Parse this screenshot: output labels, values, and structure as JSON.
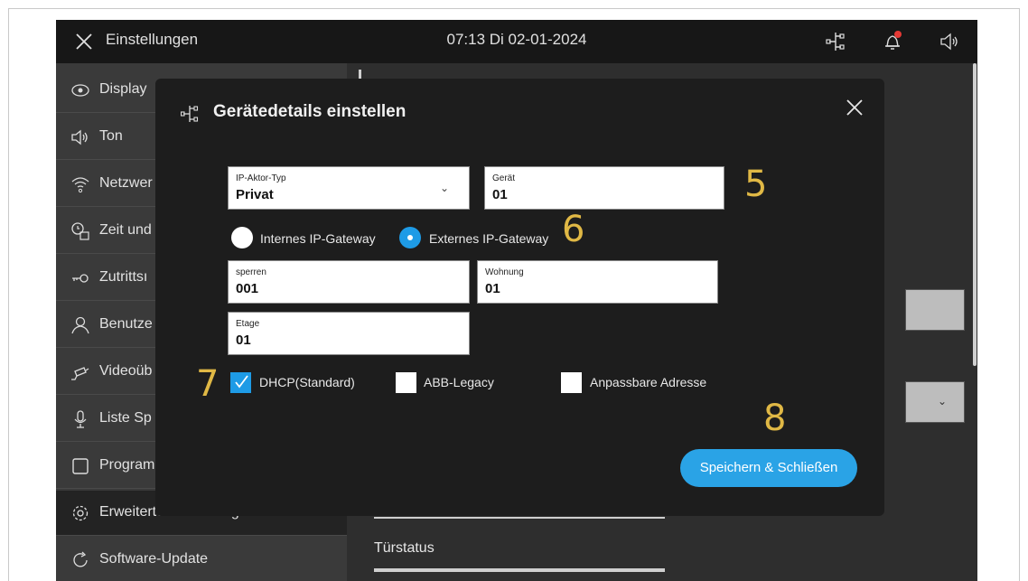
{
  "topbar": {
    "title": "Einstellungen",
    "clock": "07:13  Di 02-01-2024",
    "icons": [
      "close-icon",
      "network-tree-icon",
      "bell-icon",
      "speaker-icon"
    ],
    "notification_color": "#e53935"
  },
  "sidebar": {
    "items": [
      {
        "label": "Display",
        "icon": "eye-icon"
      },
      {
        "label": "Ton",
        "icon": "speaker-icon"
      },
      {
        "label": "Netzwer",
        "icon": "wifi-icon"
      },
      {
        "label": "Zeit und",
        "icon": "clock-calendar-icon"
      },
      {
        "label": "Zutrittsı",
        "icon": "key-icon"
      },
      {
        "label": "Benutze",
        "icon": "user-icon"
      },
      {
        "label": "Videoüb",
        "icon": "camera-icon"
      },
      {
        "label": "Liste Sp",
        "icon": "microphone-icon"
      },
      {
        "label": "Program",
        "icon": "square-icon"
      },
      {
        "label": "Erweiterte Einstellungen",
        "icon": "gear-icon"
      },
      {
        "label": "Software-Update",
        "icon": "refresh-icon"
      }
    ]
  },
  "background": {
    "door_status_label": "Türstatus"
  },
  "modal": {
    "title": "Gerätedetails einstellen",
    "fields": {
      "ip_actor_type": {
        "label": "IP-Aktor-Typ",
        "value": "Privat"
      },
      "device": {
        "label": "Gerät",
        "value": "01"
      },
      "lock": {
        "label": "sperren",
        "value": "001"
      },
      "apartment": {
        "label": "Wohnung",
        "value": "01"
      },
      "floor": {
        "label": "Etage",
        "value": "01"
      }
    },
    "radios": [
      {
        "label": "Internes IP-Gateway",
        "selected": false
      },
      {
        "label": "Externes IP-Gateway",
        "selected": true
      }
    ],
    "checkboxes": [
      {
        "label": "DHCP(Standard)",
        "checked": true
      },
      {
        "label": "ABB-Legacy",
        "checked": false
      },
      {
        "label": "Anpassbare Adresse",
        "checked": false
      }
    ],
    "save_label": "Speichern & Schließen",
    "accent": "#1e9be6"
  },
  "callouts": [
    "5",
    "6",
    "7",
    "8"
  ],
  "callout_color": "#e0b845"
}
